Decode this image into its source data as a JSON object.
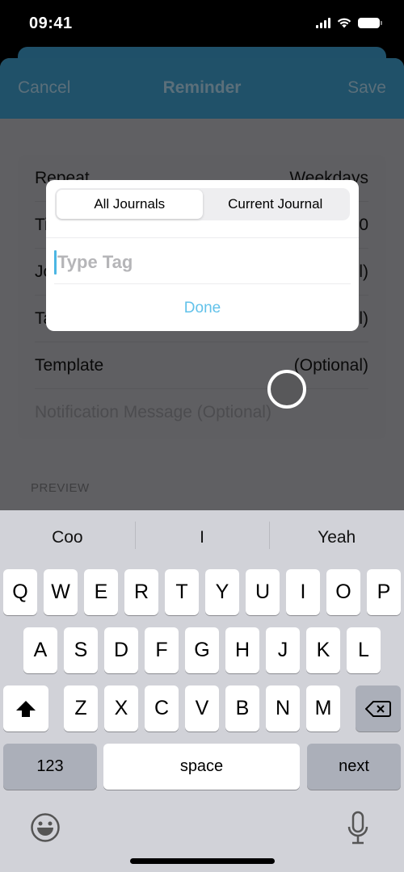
{
  "status_bar": {
    "time": "09:41",
    "icons": [
      "cellular-signal-icon",
      "wifi-icon",
      "battery-icon"
    ]
  },
  "navbar": {
    "cancel_label": "Cancel",
    "title": "Reminder",
    "save_label": "Save",
    "color": "#205169"
  },
  "form": {
    "rows": [
      {
        "label": "Repeat",
        "value": "Weekdays"
      },
      {
        "label": "Time",
        "value": "0"
      },
      {
        "label": "Journal",
        "value": "l)"
      },
      {
        "label": "Tag",
        "value": "l)"
      },
      {
        "label": "Template",
        "value": "(Optional)"
      }
    ],
    "notification_placeholder": "Notification Message (Optional)",
    "preview_label": "PREVIEW"
  },
  "dialog": {
    "segments": [
      {
        "label": "All Journals",
        "selected": true
      },
      {
        "label": "Current Journal",
        "selected": false
      }
    ],
    "tag_input": {
      "value": "",
      "placeholder": "Type Tag"
    },
    "done_label": "Done",
    "accent_color": "#62c2ea"
  },
  "keyboard": {
    "suggestions": [
      "Coo",
      "I",
      "Yeah"
    ],
    "rows": [
      [
        "Q",
        "W",
        "E",
        "R",
        "T",
        "Y",
        "U",
        "I",
        "O",
        "P"
      ],
      [
        "A",
        "S",
        "D",
        "F",
        "G",
        "H",
        "J",
        "K",
        "L"
      ],
      [
        "Z",
        "X",
        "C",
        "V",
        "B",
        "N",
        "M"
      ]
    ],
    "numbers_label": "123",
    "space_label": "space",
    "return_label": "next",
    "icons": [
      "shift-icon",
      "backspace-icon",
      "emoji-icon",
      "microphone-icon"
    ]
  }
}
